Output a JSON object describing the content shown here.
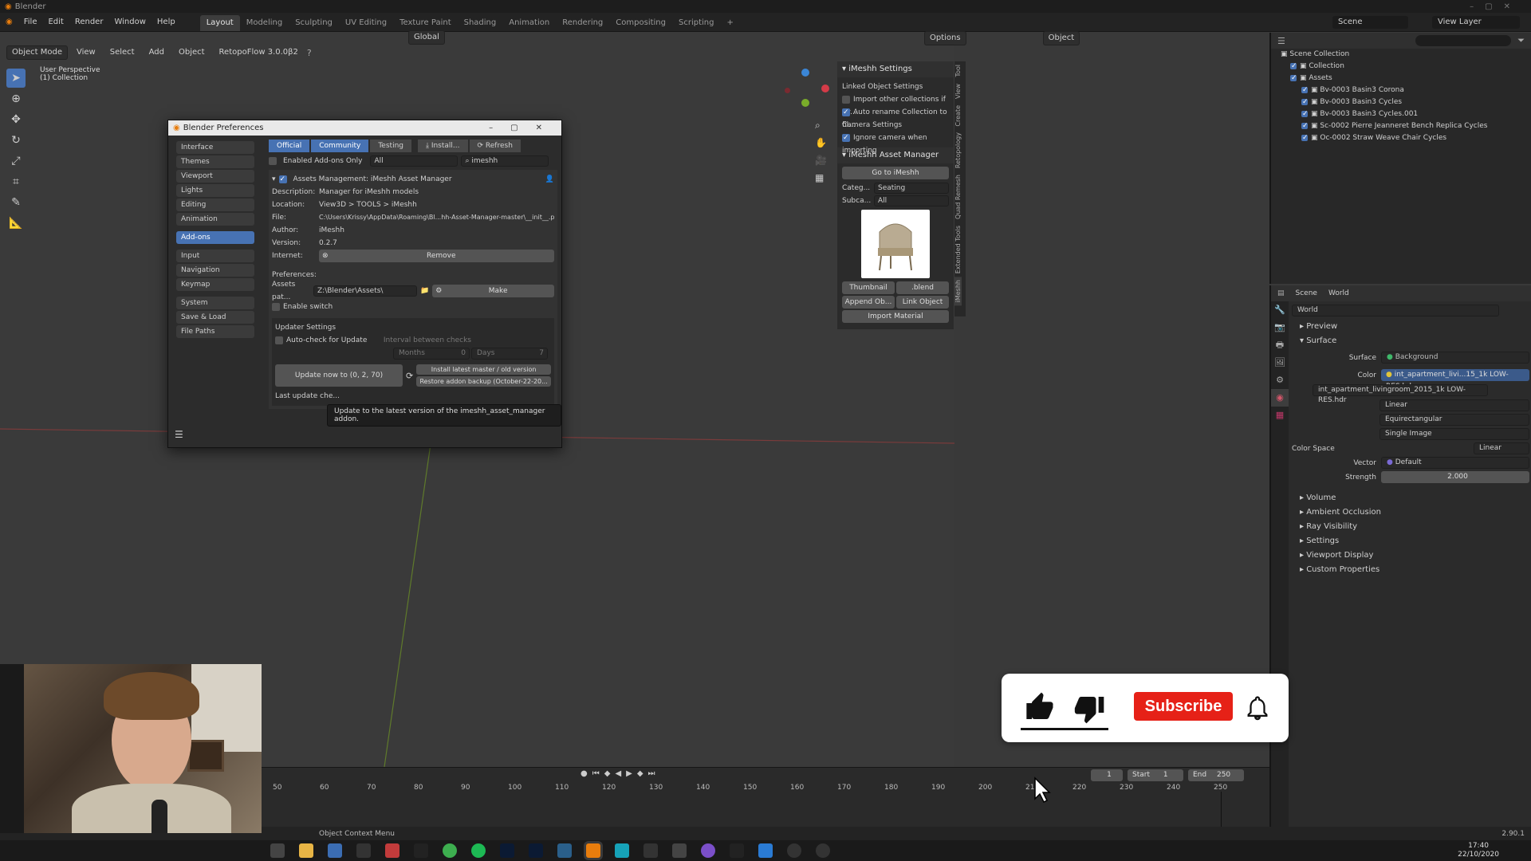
{
  "window": {
    "title": "Blender"
  },
  "menubar": {
    "items": [
      "File",
      "Edit",
      "Render",
      "Window",
      "Help"
    ]
  },
  "workspaces": [
    "Layout",
    "Modeling",
    "Sculpting",
    "UV Editing",
    "Texture Paint",
    "Shading",
    "Animation",
    "Rendering",
    "Compositing",
    "Scripting"
  ],
  "topright": {
    "scene": "Scene",
    "view_layer": "View Layer"
  },
  "viewport_header": {
    "mode": "Object Mode",
    "menus": [
      "View",
      "Select",
      "Add",
      "Object"
    ],
    "addon_menu": "RetopoFlow 3.0.0β2",
    "orientation": "Global",
    "options": "Options",
    "object_label": "Object"
  },
  "viewport": {
    "perspective": "User Perspective",
    "collection": "(1) Collection"
  },
  "imeshh_settings": {
    "header": "iMeshh Settings",
    "linked_label": "Linked Object Settings",
    "import_other": "Import other collections if av...",
    "auto_rename": "Auto rename Collection to fil...",
    "camera_label": "Camera Settings",
    "ignore_camera": "Ignore camera when importing"
  },
  "asset_manager": {
    "header": "iMeshh Asset Manager",
    "goto": "Go to iMeshh",
    "categ_label": "Categ...",
    "categ_value": "Seating",
    "subca_label": "Subca...",
    "subca_value": "All",
    "thumbnail": "Thumbnail",
    "blend": ".blend",
    "append": "Append Ob...",
    "link": "Link Object",
    "import_material": "Import Material"
  },
  "vtabs": [
    "Tool",
    "View",
    "Create",
    "Retopology",
    "Quad Remesh",
    "Extended Tools",
    "iMeshh"
  ],
  "outliner": {
    "root": "Scene Collection",
    "rows": [
      {
        "name": "Collection",
        "indent": 1
      },
      {
        "name": "Assets",
        "indent": 1
      },
      {
        "name": "Bv-0003 Basin3 Corona",
        "indent": 2
      },
      {
        "name": "Bv-0003 Basin3 Cycles",
        "indent": 2
      },
      {
        "name": "Bv-0003 Basin3 Cycles.001",
        "indent": 2
      },
      {
        "name": "Sc-0002 Pierre Jeanneret Bench Replica Cycles",
        "indent": 2
      },
      {
        "name": "Oc-0002 Straw Weave Chair Cycles",
        "indent": 2
      }
    ]
  },
  "properties": {
    "scene": "Scene",
    "world_tab": "World",
    "world_name": "World",
    "preview": "Preview",
    "surface_section": "Surface",
    "surface_label": "Surface",
    "surface_value": "Background",
    "color_label": "Color",
    "color_value": "int_apartment_livi...15_1k LOW-RES.hdr",
    "image_name": "int_apartment_livingroom_2015_1k LOW-RES.hdr",
    "interp": "Linear",
    "projection": "Equirectangular",
    "source": "Single Image",
    "colorspace_label": "Color Space",
    "colorspace_value": "Linear",
    "vector_label": "Vector",
    "vector_value": "Default",
    "strength_label": "Strength",
    "strength_value": "2.000",
    "sections": [
      "Volume",
      "Ambient Occlusion",
      "Ray Visibility",
      "Settings",
      "Viewport Display",
      "Custom Properties"
    ]
  },
  "prefs": {
    "title": "Blender Preferences",
    "nav_groups": [
      [
        "Interface",
        "Themes",
        "Viewport",
        "Lights",
        "Editing",
        "Animation"
      ],
      [
        "Add-ons"
      ],
      [
        "Input",
        "Navigation",
        "Keymap"
      ],
      [
        "System",
        "Save & Load",
        "File Paths"
      ]
    ],
    "active_nav": "Add-ons",
    "tabs": [
      "Official",
      "Community",
      "Testing"
    ],
    "install": "Install...",
    "refresh": "Refresh",
    "enabled_only": "Enabled Add-ons Only",
    "filter": "All",
    "search": "imeshh",
    "addon_title": "Assets Management: iMeshh Asset Manager",
    "fields": [
      {
        "k": "Description:",
        "v": "Manager for iMeshh models"
      },
      {
        "k": "Location:",
        "v": "View3D > TOOLS > iMeshh"
      },
      {
        "k": "File:",
        "v": "C:\\Users\\Krissy\\AppData\\Roaming\\Bl...hh-Asset-Manager-master\\__init__.py"
      },
      {
        "k": "Author:",
        "v": "iMeshh"
      },
      {
        "k": "Version:",
        "v": "0.2.7"
      }
    ],
    "internet": "Internet:",
    "remove": "Remove",
    "preferences": "Preferences:",
    "assets_path_label": "Assets pat...",
    "assets_path": "Z:\\Blender\\Assets\\",
    "make": "Make",
    "enable_switch": "Enable switch",
    "updater": "Updater Settings",
    "autocheck": "Auto-check for Update",
    "interval": "Interval between checks",
    "months": "Months",
    "months_val": "0",
    "days": "Days",
    "days_val": "7",
    "update_now": "Update now to (0, 2, 70)",
    "install_latest": "Install latest master / old version",
    "restore": "Restore addon backup (October-22-20...",
    "last_update": "Last update che...",
    "tooltip": "Update to the latest version of the imeshh_asset_manager addon."
  },
  "timeline": {
    "current": "1",
    "start_label": "Start",
    "start": "1",
    "end_label": "End",
    "end": "250",
    "ticks": [
      "50",
      "60",
      "70",
      "80",
      "90",
      "100",
      "110",
      "120",
      "130",
      "140",
      "150",
      "160",
      "170",
      "180",
      "190",
      "200",
      "210",
      "220",
      "230",
      "240",
      "250"
    ]
  },
  "status": {
    "context": "Object Context Menu",
    "version": "2.90.1"
  },
  "taskbar": {
    "time": "17:40",
    "date": "22/10/2020"
  },
  "overlay": {
    "subscribe": "Subscribe"
  }
}
